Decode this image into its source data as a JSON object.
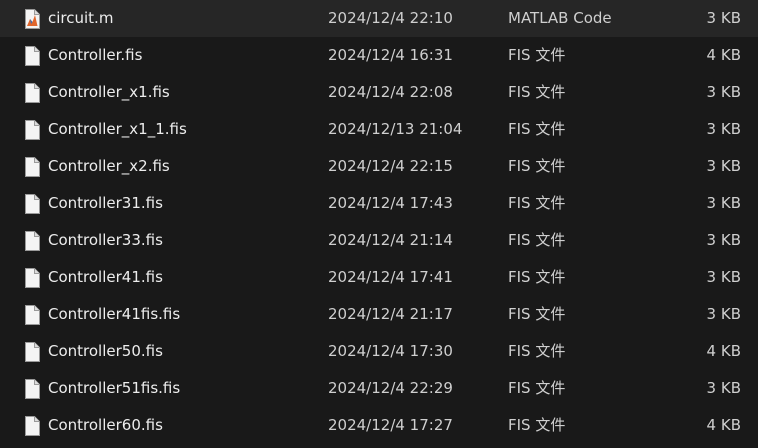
{
  "files": [
    {
      "name": "circuit.m",
      "date": "2024/12/4 22:10",
      "type": "MATLAB Code",
      "size": "3 KB",
      "icon": "matlab-file-icon"
    },
    {
      "name": "Controller.fis",
      "date": "2024/12/4 16:31",
      "type": "FIS 文件",
      "size": "4 KB",
      "icon": "document-file-icon"
    },
    {
      "name": "Controller_x1.fis",
      "date": "2024/12/4 22:08",
      "type": "FIS 文件",
      "size": "3 KB",
      "icon": "document-file-icon"
    },
    {
      "name": "Controller_x1_1.fis",
      "date": "2024/12/13 21:04",
      "type": "FIS 文件",
      "size": "3 KB",
      "icon": "document-file-icon"
    },
    {
      "name": "Controller_x2.fis",
      "date": "2024/12/4 22:15",
      "type": "FIS 文件",
      "size": "3 KB",
      "icon": "document-file-icon"
    },
    {
      "name": "Controller31.fis",
      "date": "2024/12/4 17:43",
      "type": "FIS 文件",
      "size": "3 KB",
      "icon": "document-file-icon"
    },
    {
      "name": "Controller33.fis",
      "date": "2024/12/4 21:14",
      "type": "FIS 文件",
      "size": "3 KB",
      "icon": "document-file-icon"
    },
    {
      "name": "Controller41.fis",
      "date": "2024/12/4 17:41",
      "type": "FIS 文件",
      "size": "3 KB",
      "icon": "document-file-icon"
    },
    {
      "name": "Controller41fis.fis",
      "date": "2024/12/4 21:17",
      "type": "FIS 文件",
      "size": "3 KB",
      "icon": "document-file-icon"
    },
    {
      "name": "Controller50.fis",
      "date": "2024/12/4 17:30",
      "type": "FIS 文件",
      "size": "4 KB",
      "icon": "document-file-icon"
    },
    {
      "name": "Controller51fis.fis",
      "date": "2024/12/4 22:29",
      "type": "FIS 文件",
      "size": "3 KB",
      "icon": "document-file-icon"
    },
    {
      "name": "Controller60.fis",
      "date": "2024/12/4 17:27",
      "type": "FIS 文件",
      "size": "4 KB",
      "icon": "document-file-icon"
    }
  ],
  "colors": {
    "background": "#191919",
    "text": "#e6e6e6",
    "matlab_accent": "#e0662c"
  }
}
